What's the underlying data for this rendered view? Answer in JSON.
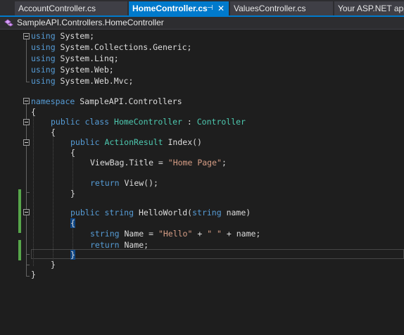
{
  "tabs": [
    {
      "label": "AccountController.cs"
    },
    {
      "label": "HomeController.cs",
      "pin": "⊣",
      "close": "✕"
    },
    {
      "label": "ValuesController.cs"
    },
    {
      "label": "Your ASP.NET app"
    }
  ],
  "navbar": {
    "icon": "class-icon",
    "path": "SampleAPI.Controllers.HomeController"
  },
  "colors": {
    "keyword": "#569cd6",
    "type": "#4ec9b0",
    "string": "#d69d85",
    "text": "#dcdcdc",
    "accent": "#007acc",
    "change_bar": "#57a64a"
  },
  "code": {
    "l1": {
      "kw": "using",
      "rest": " System;"
    },
    "l2": {
      "kw": "using",
      "rest": " System.Collections.Generic;"
    },
    "l3": {
      "kw": "using",
      "rest": " System.Linq;"
    },
    "l4": {
      "kw": "using",
      "rest": " System.Web;"
    },
    "l5": {
      "kw": "using",
      "rest": " System.Web.Mvc;"
    },
    "l6": {
      "kw": "namespace",
      "rest": " SampleAPI.Controllers"
    },
    "l7": {
      "text": "{"
    },
    "l8": {
      "kw1": "public",
      "kw2": " class",
      "ty1": "HomeController",
      "sep": " : ",
      "ty2": "Controller"
    },
    "l9": {
      "text": "{"
    },
    "l10": {
      "kw": "public",
      "ty": "ActionResult",
      "rest": " Index()"
    },
    "l11": {
      "text": "{"
    },
    "l12": {
      "pre": "ViewBag.Title = ",
      "str": "\"Home Page\"",
      "post": ";"
    },
    "l13": {
      "kw": "return",
      "rest": " View();"
    },
    "l14": {
      "text": "}"
    },
    "l15": {
      "kw1": "public",
      "kw2": " string",
      "mid": " HelloWorld(",
      "kw3": "string",
      "rest": " name)"
    },
    "l16": {
      "text": "{"
    },
    "l17": {
      "kw": "string",
      "pre": " Name = ",
      "str1": "\"Hello\"",
      "plus1": " + ",
      "str2": "\" \"",
      "post": " + name;"
    },
    "l18": {
      "kw": "return",
      "rest": " Name;"
    },
    "l19": {
      "text": "}"
    },
    "l20": {
      "text": "}"
    },
    "l21": {
      "text": "}"
    }
  }
}
